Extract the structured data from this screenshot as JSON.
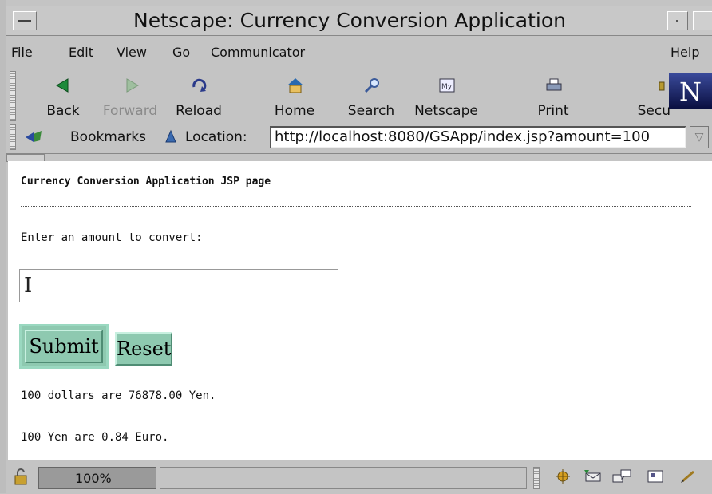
{
  "window": {
    "title": "Netscape: Currency Conversion Application"
  },
  "menubar": {
    "items": [
      "File",
      "Edit",
      "View",
      "Go",
      "Communicator"
    ],
    "help": "Help"
  },
  "toolbar": {
    "buttons": [
      {
        "label": "Back",
        "icon": "back-arrow-icon",
        "enabled": true
      },
      {
        "label": "Forward",
        "icon": "forward-arrow-icon",
        "enabled": false
      },
      {
        "label": "Reload",
        "icon": "reload-icon",
        "enabled": true
      },
      {
        "label": "Home",
        "icon": "home-icon",
        "enabled": true
      },
      {
        "label": "Search",
        "icon": "search-icon",
        "enabled": true
      },
      {
        "label": "Netscape",
        "icon": "my-netscape-icon",
        "enabled": true
      },
      {
        "label": "Print",
        "icon": "print-icon",
        "enabled": true
      },
      {
        "label": "Secu",
        "icon": "security-icon",
        "enabled": true
      }
    ],
    "logo": "N"
  },
  "location_bar": {
    "bookmarks_label": "Bookmarks",
    "location_label": "Location:",
    "url": "http://localhost:8080/GSApp/index.jsp?amount=100"
  },
  "page": {
    "heading": "Currency Conversion Application JSP page",
    "prompt": "Enter an amount to convert:",
    "amount_value": "",
    "submit_label": "Submit",
    "reset_label": "Reset",
    "result_yen": "100 dollars are 76878.00 Yen.",
    "result_euro": "100 Yen are 0.84 Euro."
  },
  "statusbar": {
    "zoom": "100%",
    "message": ""
  },
  "colors": {
    "chrome": "#c4c4c4",
    "button_face": "#8ec9b0",
    "content_bg": "#ffffff"
  }
}
